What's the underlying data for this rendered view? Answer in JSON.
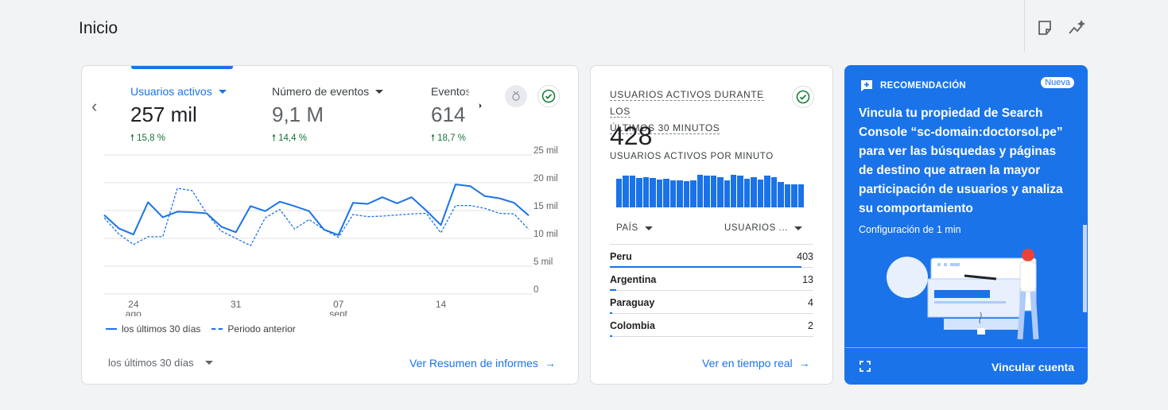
{
  "header": {
    "title": "Inicio",
    "icons": [
      "note-icon",
      "insights-icon"
    ]
  },
  "overview": {
    "metrics": [
      {
        "label": "Usuarios activos",
        "value": "257 mil",
        "change": "15,8 %",
        "active": true
      },
      {
        "label": "Número de eventos",
        "value": "9,1 M",
        "change": "14,4 %",
        "active": false
      },
      {
        "label": "Eventos",
        "value": "614",
        "change": "18,7 %",
        "active": false
      }
    ],
    "legend_current": "los últimos 30 días",
    "legend_previous": "Periodo anterior",
    "date_range": "los últimos 30 días",
    "link": "Ver Resumen de informes"
  },
  "chart_data": {
    "type": "line",
    "y_ticks": [
      "25 mil",
      "20 mil",
      "15 mil",
      "10 mil",
      "5 mil",
      "0"
    ],
    "ylim": [
      0,
      25000
    ],
    "x_ticks": [
      {
        "label": "24",
        "sub": "ago",
        "index": 2
      },
      {
        "label": "31",
        "sub": "",
        "index": 9
      },
      {
        "label": "07",
        "sub": "sept",
        "index": 16
      },
      {
        "label": "14",
        "sub": "",
        "index": 23
      }
    ],
    "series": [
      {
        "name": "los últimos 30 días",
        "style": "solid",
        "values": [
          14200,
          11800,
          10700,
          16500,
          13800,
          14800,
          14700,
          14500,
          12100,
          11100,
          15800,
          14900,
          16600,
          15800,
          14900,
          11600,
          10600,
          16400,
          16200,
          17400,
          16300,
          17400,
          15000,
          12400,
          19700,
          19400,
          17600,
          17200,
          16400,
          14100
        ]
      },
      {
        "name": "Periodo anterior",
        "style": "dashed",
        "values": [
          13700,
          10800,
          8900,
          10300,
          10300,
          19000,
          18600,
          14500,
          11300,
          10000,
          8700,
          13700,
          15200,
          11700,
          13400,
          11600,
          10200,
          14300,
          13900,
          14000,
          14200,
          14400,
          14500,
          11000,
          15900,
          15900,
          15400,
          14500,
          14400,
          11600
        ]
      }
    ]
  },
  "realtime": {
    "title_line1": "USUARIOS ACTIVOS DURANTE LOS",
    "title_line2": "ÚLTIMOS 30 MINUTOS",
    "value": "428",
    "subtitle": "USUARIOS ACTIVOS POR MINUTO",
    "bars": [
      0.78,
      0.86,
      0.88,
      0.8,
      0.83,
      0.8,
      0.76,
      0.78,
      0.74,
      0.74,
      0.72,
      0.74,
      0.9,
      0.88,
      0.86,
      0.82,
      0.74,
      0.9,
      0.86,
      0.78,
      0.82,
      0.76,
      0.86,
      0.82,
      0.7,
      0.64,
      0.64,
      0.62
    ],
    "col_country": "PAÍS",
    "col_users": "USUARIOS ...",
    "rows": [
      {
        "country": "Peru",
        "users": "403",
        "share": 0.94
      },
      {
        "country": "Argentina",
        "users": "13",
        "share": 0.03
      },
      {
        "country": "Paraguay",
        "users": "4",
        "share": 0.01
      },
      {
        "country": "Colombia",
        "users": "2",
        "share": 0.005
      }
    ],
    "link": "Ver en tiempo real"
  },
  "recommendation": {
    "label": "RECOMENDACIÓN",
    "badge": "Nueva",
    "text": "Vincula tu propiedad de Search Console “sc-domain:doctorsol.pe” para ver las búsquedas y páginas de destino que atraen la mayor participación de usuarios y analiza su comportamiento",
    "sub": "Configuración de 1 min",
    "action": "Vincular cuenta"
  },
  "colors": {
    "accent": "#1a73e8",
    "positive": "#137333",
    "success_check": "#188038"
  }
}
